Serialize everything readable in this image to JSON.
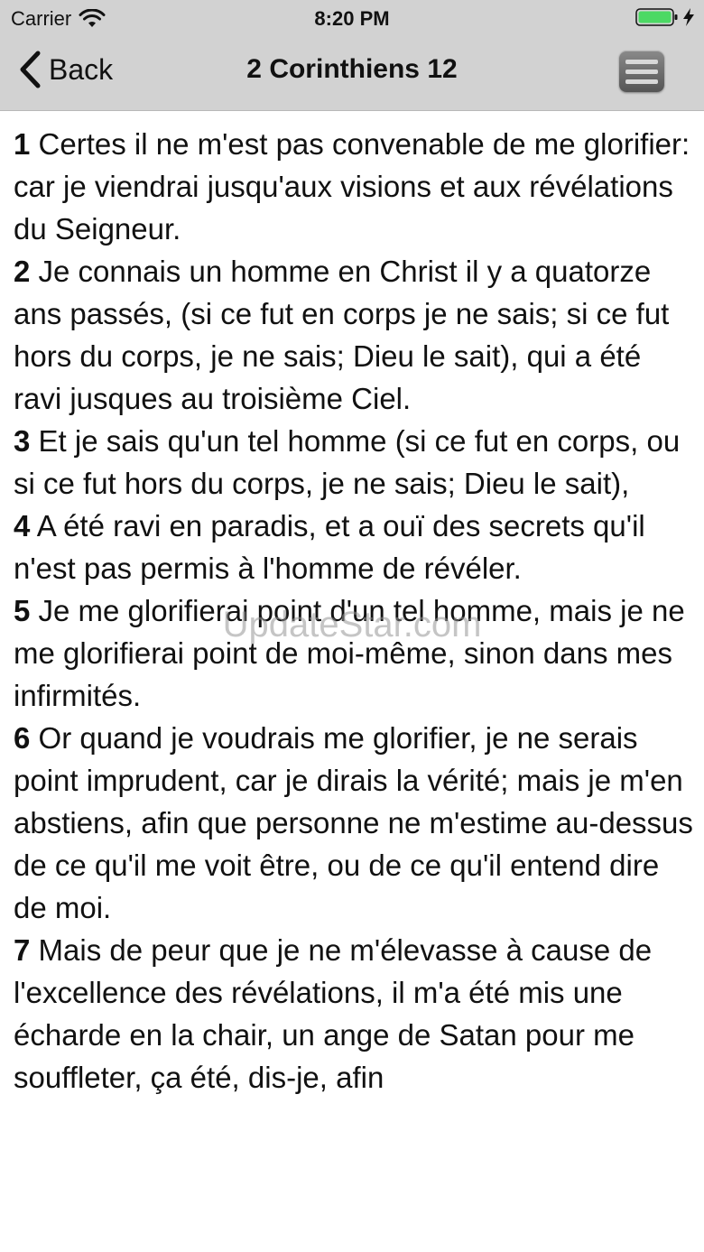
{
  "status_bar": {
    "carrier": "Carrier",
    "time": "8:20 PM",
    "battery_color": "#4cd964"
  },
  "nav": {
    "back_label": "Back",
    "title": "2 Corinthiens 12",
    "menu_icon": "hamburger-menu-icon"
  },
  "verses": [
    {
      "num": "1",
      "text": " Certes il ne m'est pas convenable de me glorifier: car je viendrai jusqu'aux visions et aux révélations du Seigneur."
    },
    {
      "num": "2",
      "text": " Je connais un homme en Christ il y a quatorze ans passés, (si ce fut en corps je ne sais; si ce fut hors du corps, je ne sais; Dieu le sait), qui a été ravi jusques au troisième Ciel."
    },
    {
      "num": "3",
      "text": " Et je sais qu'un tel homme (si ce fut en corps, ou si ce fut hors du corps, je ne sais; Dieu le sait),"
    },
    {
      "num": "4",
      "text": " A été ravi en paradis, et a ouï des secrets qu'il n'est pas permis à l'homme de révéler."
    },
    {
      "num": "5",
      "text": " Je me glorifierai point d'un tel homme, mais je ne me glorifierai point de moi-même, sinon dans mes infirmités."
    },
    {
      "num": "6",
      "text": " Or quand je voudrais me glorifier, je ne serais point imprudent, car je dirais la vérité; mais je m'en abstiens, afin que personne ne m'estime au-dessus de ce qu'il me voit être, ou de ce qu'il entend dire de moi."
    },
    {
      "num": "7",
      "text": " Mais de peur que je ne m'élevasse à cause de l'excellence des révélations, il m'a été mis une écharde en la chair, un ange de Satan pour me souffleter, ça été, dis-je, afin"
    }
  ],
  "watermark": "UpdateStar.com"
}
